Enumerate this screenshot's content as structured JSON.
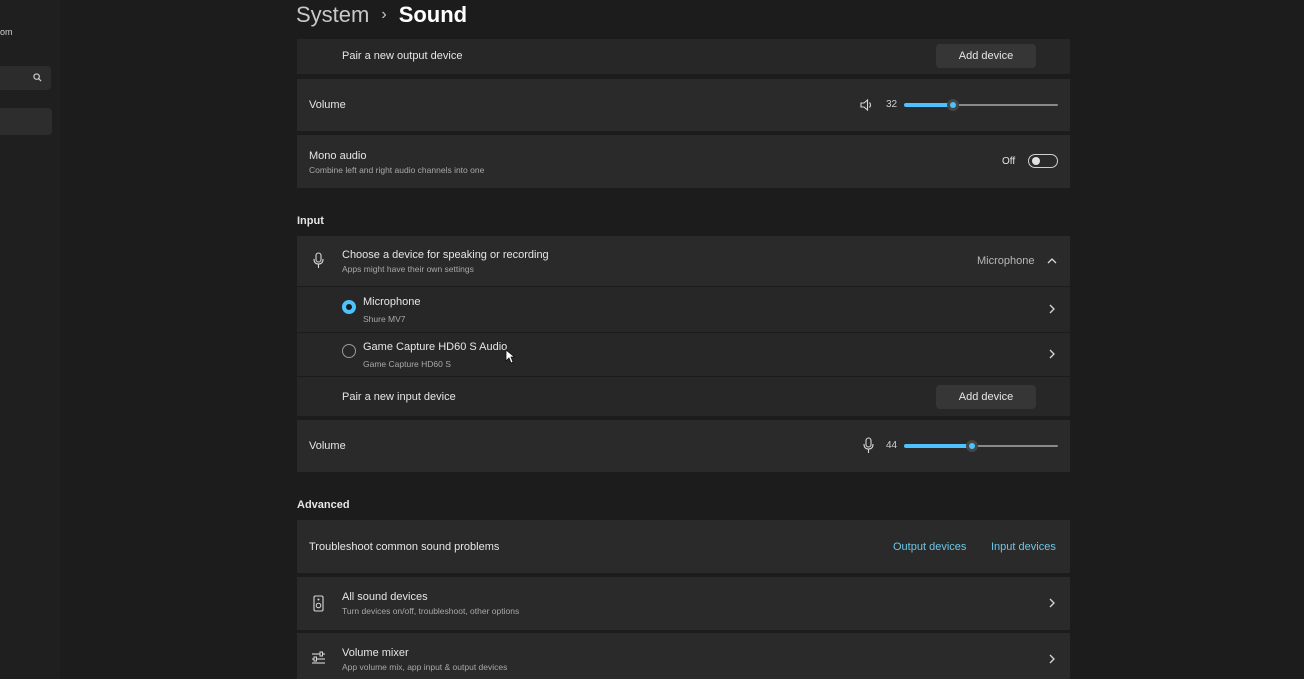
{
  "sidebar": {
    "title_fragment": "om"
  },
  "breadcrumb": {
    "parent": "System",
    "separator": "›",
    "current": "Sound"
  },
  "output": {
    "pair_label": "Pair a new output device",
    "add_device": "Add device",
    "volume_label": "Volume",
    "volume_value": "32",
    "volume_level": 32,
    "mono_title": "Mono audio",
    "mono_desc": "Combine left and right audio channels into one",
    "mono_state": "Off"
  },
  "input": {
    "section_title": "Input",
    "choose_title": "Choose a device for speaking or recording",
    "choose_desc": "Apps might have their own settings",
    "selected_device": "Microphone",
    "devices": [
      {
        "name": "Microphone",
        "sub": "Shure MV7",
        "selected": true
      },
      {
        "name": "Game Capture HD60 S Audio",
        "sub": "Game Capture HD60 S",
        "selected": false
      }
    ],
    "pair_label": "Pair a new input device",
    "add_device": "Add device",
    "volume_label": "Volume",
    "volume_value": "44",
    "volume_level": 44
  },
  "advanced": {
    "section_title": "Advanced",
    "troubleshoot_label": "Troubleshoot common sound problems",
    "output_link": "Output devices",
    "input_link": "Input devices",
    "all_devices_title": "All sound devices",
    "all_devices_desc": "Turn devices on/off, troubleshoot, other options",
    "mixer_title": "Volume mixer",
    "mixer_desc": "App volume mix, app input & output devices"
  },
  "colors": {
    "accent": "#4cc2ff",
    "link": "#6cc6e6",
    "card": "#2a2a2a",
    "background": "#1c1c1c"
  }
}
